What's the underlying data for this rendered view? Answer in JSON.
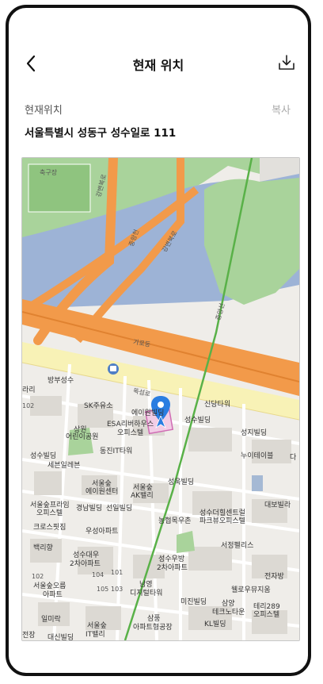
{
  "header": {
    "title": "현재 위치"
  },
  "location": {
    "label": "현재위치",
    "copy_label": "복사",
    "address": "서울특별시 성동구 성수일로 111"
  },
  "map": {
    "labels": {
      "l1": "축구장",
      "l2": "강변북로",
      "l3": "강변북로",
      "l4": "중랑천",
      "l5": "중앙선",
      "l6": "가로등",
      "l7": "뚝섬로",
      "l8": "방부성수",
      "l9": "라리",
      "l10": "SK주유소",
      "l11": "에이원빌딩",
      "l12": "ESA리버하우스",
      "l13": "오피스텔",
      "l14": "신당타워",
      "l15": "성지빌딩",
      "l16": "성수빌딩",
      "l17": "누이테이블",
      "l18": "상원",
      "l19": "어린이공원",
      "l20": "동진IT타워",
      "l21": "세븐일레븐",
      "l22": "서울숲",
      "l23": "에이원센터",
      "l24": "서울숲",
      "l25": "AK밸리",
      "l26": "성욱빌딩",
      "l27": "서울숲프라임",
      "l28": "오피스텔",
      "l29": "경남빌딩",
      "l30": "선일빌딩",
      "l31": "성수더힐센트럴",
      "l32": "파크뷰오피스텔",
      "l33": "대보빌라",
      "l34": "농협목우촌",
      "l35": "크로스핏짐",
      "l36": "우성아파트",
      "l37": "서정펠리스",
      "l38": "성수대우",
      "l39": "2차아파트",
      "l40": "성수우방",
      "l41": "2차아파트",
      "l42": "서울숲오름",
      "l43": "아파트",
      "l44": "남영",
      "l45": "디지털타워",
      "l46": "전자방",
      "l47": "웰로우뮤지움",
      "l48": "미진빌딩",
      "l49": "삼양",
      "l50": "테크노타운",
      "l51": "테리289",
      "l52": "오피스텔",
      "l53": "일미락",
      "l54": "삼풍",
      "l55": "아파트형공장",
      "l56": "KL빌딩",
      "l57": "서울숲",
      "l58": "IT밸리",
      "l59": "대신빌딩",
      "l60": "백리향",
      "l61": "성수빌딩",
      "l62": "전장",
      "l63": "다",
      "l64": "102",
      "l65": "104",
      "l66": "105",
      "l67": "103",
      "l68": "101",
      "l69": "102"
    }
  },
  "colors": {
    "pin": "#2a7de1",
    "river": "#9db3d6",
    "park": "#a9d39b",
    "expressway": "#f29a4a",
    "subway": "#59b148"
  }
}
